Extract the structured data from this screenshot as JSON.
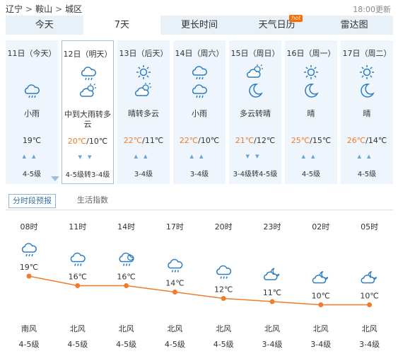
{
  "breadcrumb": {
    "province": "辽宁",
    "city": "鞍山",
    "district": "城区",
    "sep": ">"
  },
  "updated": "18:00更新",
  "tabs": [
    {
      "label": "今天",
      "active": true
    },
    {
      "label": "7天",
      "active": false
    },
    {
      "label": "更长时间",
      "active": false
    },
    {
      "label": "天气日历",
      "active": false,
      "badge": "hot"
    },
    {
      "label": "雷达图",
      "active": false
    }
  ],
  "days": [
    {
      "date": "11日（今天）",
      "icon1": "",
      "icon2": "rain",
      "desc": "小雨",
      "high": "",
      "low": "19℃",
      "sep": "",
      "arrows": "up",
      "wind": "4-5级",
      "selected": false
    },
    {
      "date": "12日（明天）",
      "icon1": "rain",
      "icon2": "partly-cloudy-day",
      "desc": "中到大雨转多云",
      "high": "20℃",
      "low": "10℃",
      "sep": "/",
      "arrows": "down",
      "wind": "4-5级转3-4级",
      "selected": true
    },
    {
      "date": "13日（后天）",
      "icon1": "sun",
      "icon2": "partly-cloudy-day",
      "desc": "晴转多云",
      "high": "22℃",
      "low": "11℃",
      "sep": "/",
      "arrows": "up",
      "wind": "3-4级",
      "selected": false
    },
    {
      "date": "14日（周六）",
      "icon1": "rain",
      "icon2": "rain",
      "desc": "小雨",
      "high": "22℃",
      "low": "10℃",
      "sep": "/",
      "arrows": "up",
      "wind": "3-4级",
      "selected": false
    },
    {
      "date": "15日（周日）",
      "icon1": "partly-cloudy-day",
      "icon2": "moon",
      "desc": "多云转晴",
      "high": "21℃",
      "low": "12℃",
      "sep": "/",
      "arrows": "down",
      "wind": "3-4级转4-5级",
      "selected": false
    },
    {
      "date": "16日（周一）",
      "icon1": "sun",
      "icon2": "moon",
      "desc": "晴",
      "high": "25℃",
      "low": "15℃",
      "sep": "/",
      "arrows": "up",
      "wind": "4-5级",
      "selected": false
    },
    {
      "date": "17日（周二）",
      "icon1": "sun",
      "icon2": "moon",
      "desc": "晴",
      "high": "26℃",
      "low": "14℃",
      "sep": "/",
      "arrows": "up",
      "wind": "4-5级",
      "selected": false
    }
  ],
  "subtabs": [
    {
      "label": "分时段预报",
      "active": true
    },
    {
      "label": "生活指数",
      "active": false
    }
  ],
  "colors": {
    "accent": "#f07d2b",
    "arrow": "#6da3cf",
    "icon": "#2b7dc0",
    "tab_bg": "#e8f0f8"
  },
  "chart_data": {
    "type": "line",
    "x": [
      "08时",
      "11时",
      "14时",
      "17时",
      "20时",
      "23时",
      "02时",
      "05时"
    ],
    "series": [
      {
        "values": [
          19,
          16,
          16,
          14,
          12,
          11,
          10,
          10
        ]
      }
    ],
    "value_labels": [
      "19℃",
      "16℃",
      "16℃",
      "14℃",
      "12℃",
      "11℃",
      "10℃",
      "10℃"
    ],
    "icons": [
      "rain",
      "rain",
      "night-rain",
      "rain",
      "rain",
      "partly-cloudy-night",
      "partly-cloudy-night",
      "partly-cloudy-night"
    ],
    "wind_dir": [
      "南风",
      "北风",
      "北风",
      "北风",
      "北风",
      "北风",
      "北风",
      "北风"
    ],
    "wind_level": [
      "4-5级",
      "4-5级",
      "4-5级",
      "4-5级",
      "4-5级",
      "3-4级",
      "3-4级",
      "3-4级"
    ]
  }
}
